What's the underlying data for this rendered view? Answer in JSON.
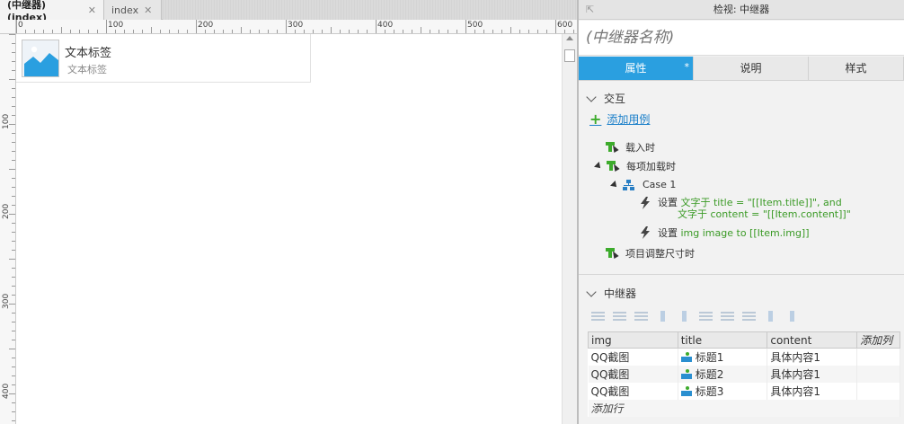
{
  "tabs": [
    {
      "label": "(中继器) (index)",
      "close": "✕"
    },
    {
      "label": "index",
      "close": "✕"
    }
  ],
  "ruler": {
    "h_labels": [
      "0",
      "100",
      "200",
      "300",
      "400",
      "500",
      "600"
    ],
    "v_labels": [
      "100",
      "200",
      "300",
      "400"
    ]
  },
  "canvas": {
    "widget_title": "文本标签",
    "widget_subtitle": "文本标签"
  },
  "panel": {
    "header": "检视: 中继器",
    "pin_icon": "⇱",
    "name_placeholder": "(中继器名称)",
    "tabs": [
      "属性",
      "说明",
      "样式"
    ],
    "tab_modified_marker": "*",
    "interactions_title": "交互",
    "add_case_label": "添加用例",
    "events": {
      "on_load": "载入时",
      "on_item_load": "每项加载时",
      "case1": "Case 1",
      "action1_prefix": "设置",
      "action1_line1": "文字于 title = \"[[Item.title]]\", and",
      "action1_line2": "文字于 content = \"[[Item.content]]\"",
      "action2_prefix": "设置",
      "action2_text": "img image to [[Item.img]]",
      "on_resize": "项目调整尺寸时"
    },
    "repeater_title": "中继器",
    "grid": {
      "columns": [
        "img",
        "title",
        "content",
        "添加列"
      ],
      "rows": [
        {
          "img": "QQ截图",
          "title": "标题1",
          "content": "具体内容1"
        },
        {
          "img": "QQ截图",
          "title": "标题2",
          "content": "具体内容1"
        },
        {
          "img": "QQ截图",
          "title": "标题3",
          "content": "具体内容1"
        }
      ],
      "add_row": "添加行"
    }
  },
  "colors": {
    "accent_tab": "#2a9fe0",
    "event_green": "#3dab2c",
    "link_blue": "#1a7fc9",
    "action_green": "#3a9a25"
  }
}
